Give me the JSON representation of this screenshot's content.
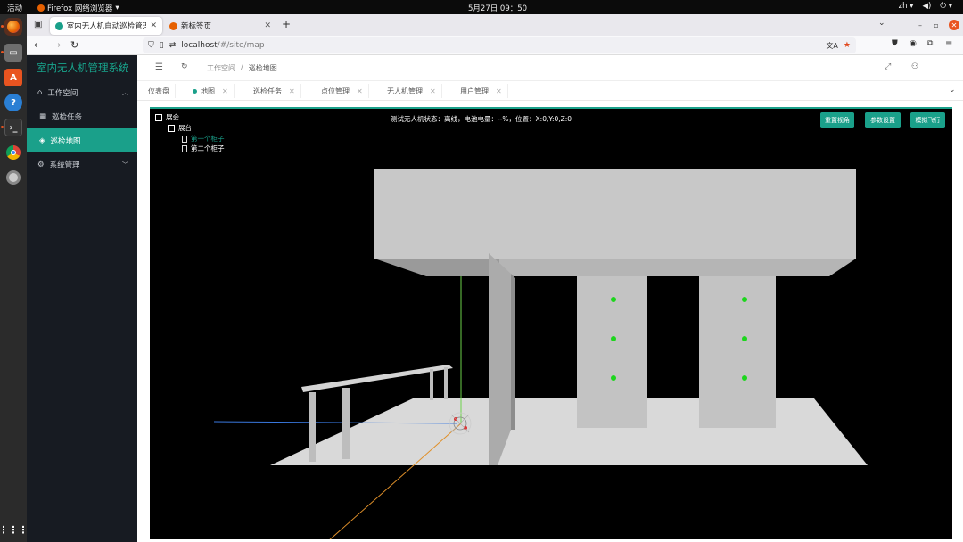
{
  "os": {
    "activities": "活动",
    "app_name": "Firefox 网络浏览器",
    "clock": "5月27日  09：50",
    "lang": "zh"
  },
  "browser": {
    "tabs": [
      {
        "title": "室内无人机自动巡检管理"
      },
      {
        "title": "新标签页"
      }
    ],
    "url_host": "localhost",
    "url_path": "/#/site/map"
  },
  "app": {
    "brand": "室内无人机管理系统",
    "menu": [
      {
        "label": "工作空间"
      },
      {
        "label": "巡检任务"
      },
      {
        "label": "巡检地图"
      },
      {
        "label": "系统管理"
      }
    ],
    "breadcrumb": [
      "工作空间",
      "巡检地图"
    ],
    "tabs": [
      {
        "label": "仪表盘"
      },
      {
        "label": "地图"
      },
      {
        "label": "巡检任务"
      },
      {
        "label": "点位管理"
      },
      {
        "label": "无人机管理"
      },
      {
        "label": "用户管理"
      }
    ]
  },
  "viewer": {
    "tree": [
      {
        "label": "展会"
      },
      {
        "label": "展台"
      },
      {
        "label": "第一个柜子"
      },
      {
        "label": "第二个柜子"
      }
    ],
    "status": "测试无人机状态：离线，电池电量：--%，位置：X:0,Y:0,Z:0",
    "buttons": {
      "reset_view": "重置视角",
      "params": "参数设置",
      "simulate": "模拟飞行"
    }
  },
  "colors": {
    "accent": "#1aa08a",
    "sidebar_bg": "#171b22",
    "scene_bg": "#000000"
  }
}
